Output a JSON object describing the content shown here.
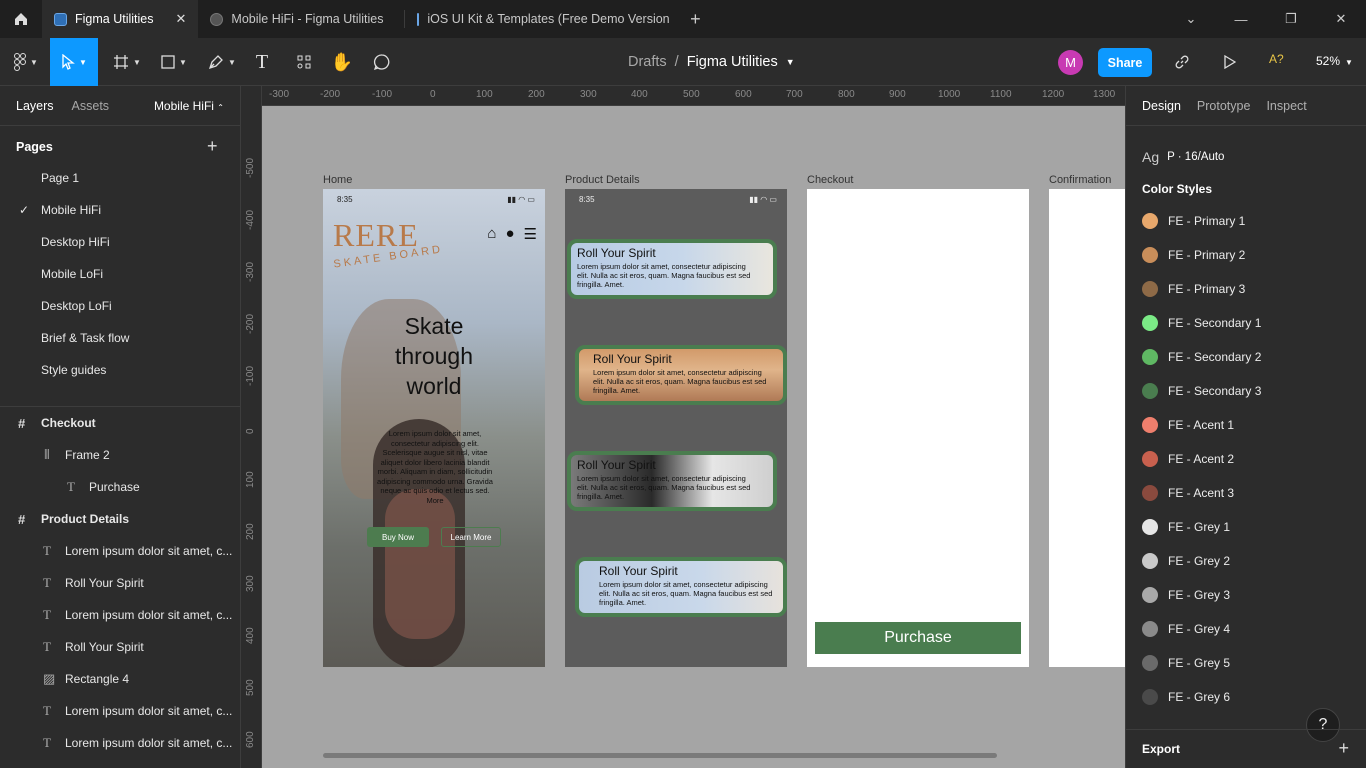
{
  "tabs": [
    {
      "title": "Figma Utilities",
      "active": true
    },
    {
      "title": "Mobile HiFi - Figma Utilities"
    },
    {
      "title": "iOS UI Kit & Templates (Free Demo Version"
    }
  ],
  "toolbar": {
    "breadcrumb_root": "Drafts",
    "separator": "/",
    "file_name": "Figma Utilities",
    "avatar_letter": "M",
    "share_label": "Share",
    "a11y_label": "A?",
    "zoom": "52%"
  },
  "left_panel": {
    "tab_layers": "Layers",
    "tab_assets": "Assets",
    "current_page": "Mobile HiFi",
    "pages_header": "Pages",
    "pages": [
      "Page 1",
      "Mobile HiFi",
      "Desktop HiFi",
      "Mobile LoFi",
      "Desktop LoFi",
      "Brief & Task flow",
      "Style guides"
    ],
    "layers": [
      {
        "name": "Checkout",
        "type": "frame"
      },
      {
        "name": "Frame 2",
        "type": "autolayout"
      },
      {
        "name": "Purchase",
        "type": "text"
      },
      {
        "name": "Product Details",
        "type": "frame"
      },
      {
        "name": "Lorem ipsum dolor sit amet, c...",
        "type": "text"
      },
      {
        "name": "Roll Your Spirit",
        "type": "text"
      },
      {
        "name": "Lorem ipsum dolor sit amet, c...",
        "type": "text"
      },
      {
        "name": "Roll Your Spirit",
        "type": "text"
      },
      {
        "name": "Rectangle 4",
        "type": "image"
      },
      {
        "name": "Lorem ipsum dolor sit amet, c...",
        "type": "text"
      },
      {
        "name": "Lorem ipsum dolor sit amet, c...",
        "type": "text"
      }
    ]
  },
  "canvas": {
    "ruler_x": [
      "-300",
      "-200",
      "-100",
      "0",
      "100",
      "200",
      "300",
      "400",
      "500",
      "600",
      "700",
      "800",
      "900",
      "1000",
      "1100",
      "1200",
      "1300"
    ],
    "ruler_y": [
      "-500",
      "-400",
      "-300",
      "-200",
      "-100",
      "0",
      "100",
      "200",
      "300",
      "400",
      "500",
      "600"
    ],
    "frames": {
      "home": "Home",
      "product": "Product Details",
      "checkout": "Checkout",
      "confirmation": "Confirmation"
    },
    "home": {
      "time": "8:35",
      "logo": "RERE",
      "sublogo": "SKATE BOARD",
      "headline": "Skate through world",
      "body": "Lorem ipsum dolor sit amet, consectetur adipiscing elit. Scelerisque augue sit nisl, vitae aliquet dolor libero lacinia blandit morbi. Aliquam in diam, sollicitudin adipiscing commodo urna. Gravida neque ac quis odio et lectus sed. More",
      "buy": "Buy Now",
      "learn": "Learn More"
    },
    "product": {
      "time": "8:35",
      "card_title": "Roll Your Spirit",
      "card_body": "Lorem ipsum dolor sit amet, consectetur adipiscing elit. Nulla ac sit eros, quam. Magna faucibus est sed fringilla. Amet."
    },
    "checkout": {
      "purchase": "Purchase"
    }
  },
  "right_panel": {
    "tab_design": "Design",
    "tab_prototype": "Prototype",
    "tab_inspect": "Inspect",
    "text_style_icon": "Ag",
    "text_style": "P · 16/Auto",
    "color_styles_header": "Color Styles",
    "color_styles": [
      {
        "name": "FE - Primary 1",
        "color": "#e8a86c"
      },
      {
        "name": "FE - Primary 2",
        "color": "#c98e5a"
      },
      {
        "name": "FE - Primary 3",
        "color": "#8e6a47"
      },
      {
        "name": "FE - Secondary 1",
        "color": "#7bea86"
      },
      {
        "name": "FE - Secondary 2",
        "color": "#5fb863"
      },
      {
        "name": "FE - Secondary 3",
        "color": "#4a7d4f"
      },
      {
        "name": "FE - Acent 1",
        "color": "#ef7f6d"
      },
      {
        "name": "FE - Acent 2",
        "color": "#c8604e"
      },
      {
        "name": "FE - Acent 3",
        "color": "#8a4a3e"
      },
      {
        "name": "FE - Grey 1",
        "color": "#e6e6e6"
      },
      {
        "name": "FE - Grey 2",
        "color": "#c9c9c9"
      },
      {
        "name": "FE - Grey 3",
        "color": "#a9a9a9"
      },
      {
        "name": "FE - Grey 4",
        "color": "#8a8a8a"
      },
      {
        "name": "FE - Grey 5",
        "color": "#6a6a6a"
      },
      {
        "name": "FE - Grey 6",
        "color": "#4a4a4a"
      }
    ],
    "help": "?",
    "export_label": "Export"
  }
}
